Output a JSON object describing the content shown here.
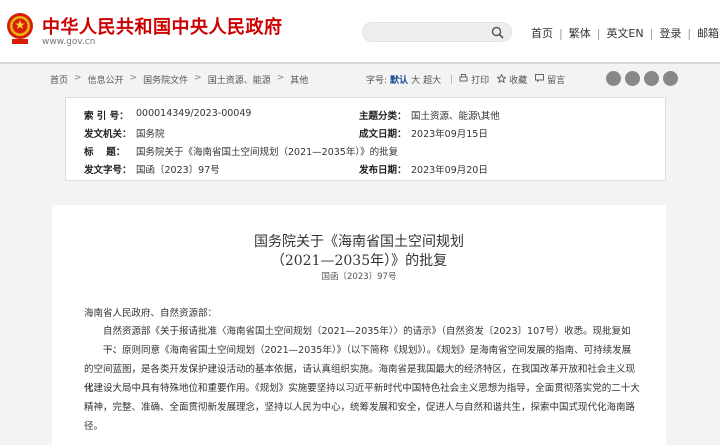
{
  "header": {
    "site_title": "中华人民共和国中央人民政府",
    "site_url": "www.gov.cn",
    "emblem_icon": "national-emblem-icon",
    "search": {
      "placeholder": ""
    },
    "nav": [
      "首页",
      "繁体",
      "英文EN",
      "登录",
      "邮箱"
    ]
  },
  "breadcrumb": [
    "首页",
    "信息公开",
    "国务院文件",
    "国土资源、能源",
    "其他"
  ],
  "toolbar": {
    "font_label": "字号:",
    "font_default": "默认",
    "font_large": "大",
    "font_xlarge": "超大",
    "print": "打印",
    "favorite": "收藏",
    "comment": "留言"
  },
  "share_icons": [
    "weibo-icon",
    "wechat-icon",
    "qq-icon",
    "close-icon"
  ],
  "info": {
    "index_label": "索 引 号：",
    "index_value": "000014349/2023-00049",
    "topic_label": "主题分类：",
    "topic_value": "国土资源、能源\\其他",
    "issuer_label": "发文机关：",
    "issuer_value": "国务院",
    "date_label": "成文日期：",
    "date_value": "2023年09月15日",
    "title_label": "标　 题：",
    "title_value": "国务院关于《海南省国土空间规划（2021—2035年）》的批复",
    "docno_label": "发文字号：",
    "docno_value": "国函〔2023〕97号",
    "pubdate_label": "发布日期：",
    "pubdate_value": "2023年09月20日"
  },
  "doc": {
    "title_line1": "国务院关于《海南省国土空间规划",
    "title_line2": "（2021—2035年）》的批复",
    "doc_no": "国函〔2023〕97号",
    "salutation": "海南省人民政府、自然资源部：",
    "para1": "自然资源部《关于报请批准〈海南省国土空间规划（2021—2035年）〉的请示》（自然资发〔2023〕107号）收悉。现批复如下：",
    "para2_l1": "一、原则同意《海南省国土空间规划（2021—2035年）》（以下简称《规划》）。《规划》是海南省空间发展的指南、可持续发展",
    "para2_l2": "的空间蓝图，是各类开发保护建设活动的基本依据，请认真组织实施。海南省是我国最大的经济特区，在我国改革开放和社会主义现代",
    "para2_l3": "化建设大局中具有特殊地位和重要作用。《规划》实施要坚持以习近平新时代中国特色社会主义思想为指导，全面贯彻落实党的二十大",
    "para2_l4": "精神，完整、准确、全面贯彻新发展理念，坚持以人民为中心，统筹发展和安全，促进人与自然和谐共生，探索中国式现代化海南路",
    "para2_l5": "径。"
  }
}
